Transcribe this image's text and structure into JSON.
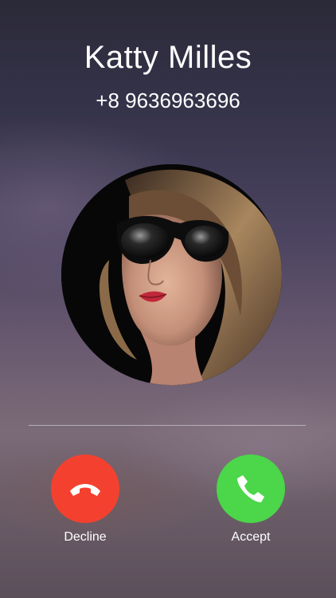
{
  "caller": {
    "name": "Katty Milles",
    "number": "+8 9636963696"
  },
  "actions": {
    "decline_label": "Decline",
    "accept_label": "Accept"
  },
  "colors": {
    "decline": "#f4412f",
    "accept": "#4cd64a",
    "text": "#ffffff"
  },
  "icons": {
    "decline": "phone-hangup-icon",
    "accept": "phone-icon"
  }
}
